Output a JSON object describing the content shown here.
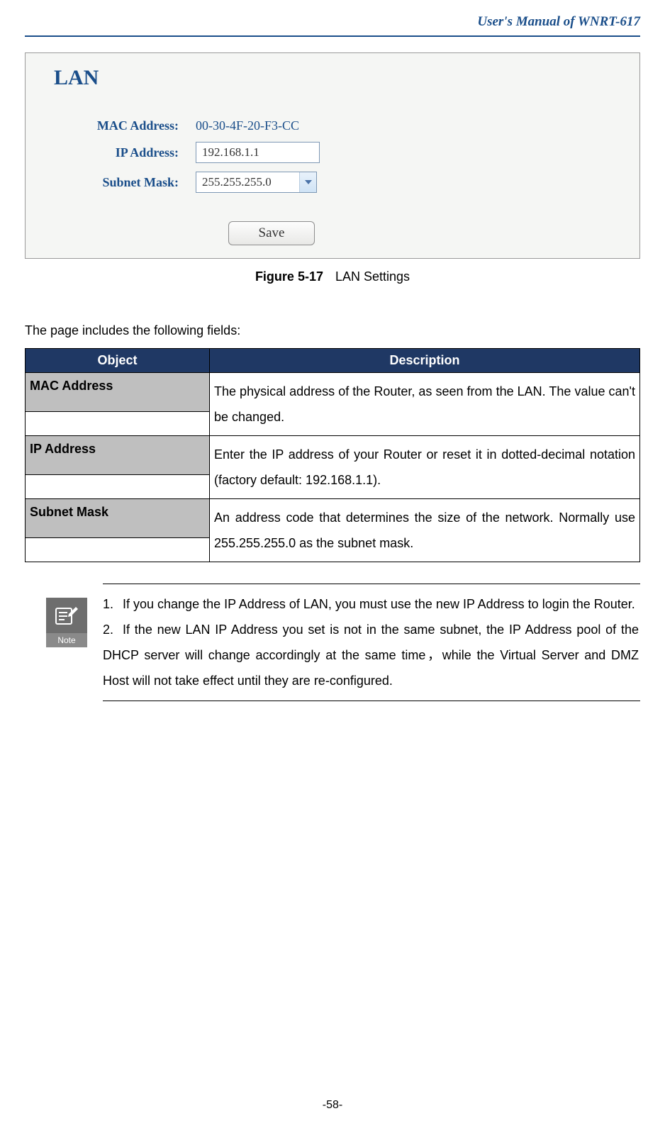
{
  "header_title": "User's  Manual  of  WNRT-617",
  "panel": {
    "title": "LAN",
    "mac_label": "MAC Address:",
    "mac_value": "00-30-4F-20-F3-CC",
    "ip_label": "IP Address:",
    "ip_value": "192.168.1.1",
    "mask_label": "Subnet Mask:",
    "mask_value": "255.255.255.0",
    "save_label": "Save"
  },
  "figure": {
    "number": "Figure 5-17",
    "caption": "LAN Settings"
  },
  "intro": "The page includes the following fields:",
  "table": {
    "head_object": "Object",
    "head_desc": "Description",
    "rows": [
      {
        "object": "MAC Address",
        "desc": "The physical address of the Router, as seen from the LAN. The value can't be changed."
      },
      {
        "object": "IP Address",
        "desc": "Enter the IP address of your Router or reset it in dotted-decimal notation (factory default: 192.168.1.1)."
      },
      {
        "object": "Subnet Mask",
        "desc": "An address code that determines the size of the network. Normally use 255.255.255.0 as the subnet mask."
      }
    ]
  },
  "note": {
    "icon_label": "Note",
    "items": [
      "If you change the IP Address of LAN, you must use the new IP Address to login the Router.",
      "If the new LAN IP Address you set is not in the same subnet, the IP Address pool of the DHCP server will change accordingly at the same time，while the Virtual Server and DMZ Host will not take effect until they are re-configured."
    ]
  },
  "page_number": "-58-"
}
